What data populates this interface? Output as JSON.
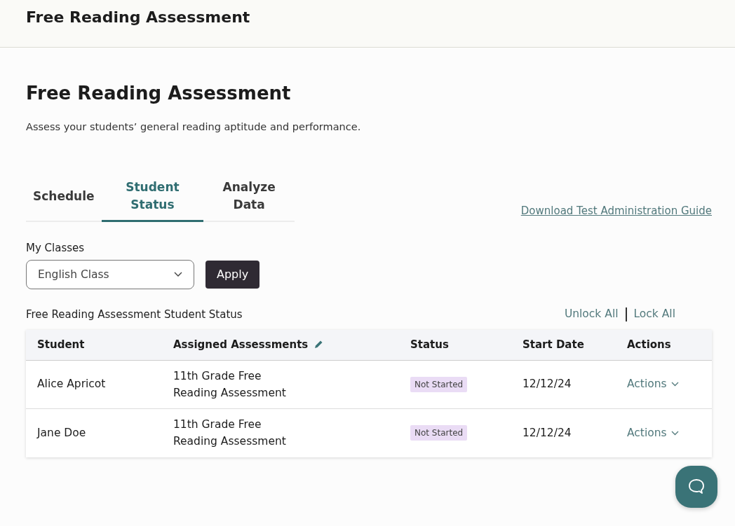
{
  "header": {
    "title": "Free Reading Assessment"
  },
  "page": {
    "title": "Free Reading Assessment",
    "subtitle": "Assess your students’ general reading aptitude and performance."
  },
  "tabs": [
    {
      "label": "Schedule",
      "selected": false
    },
    {
      "label": "Student Status",
      "selected": true
    },
    {
      "label": "Analyze Data",
      "selected": false
    }
  ],
  "guide_link": "Download Test Administration Guide",
  "class_filter": {
    "label": "My Classes",
    "value": "English Class",
    "button": "Apply"
  },
  "table": {
    "caption": "Free Reading Assessment Student Status",
    "bulk_actions": [
      "Unlock All",
      "Lock All"
    ],
    "columns": [
      "Student",
      "Assigned Assessments",
      "Status",
      "Start Date",
      "Actions"
    ],
    "rows": [
      {
        "student": "Alice Apricot",
        "assessment": "11th Grade Free Reading Assessment",
        "status": "Not Started",
        "start_date": "12/12/24",
        "actions": "Actions"
      },
      {
        "student": "Jane Doe",
        "assessment": "11th Grade Free Reading Assessment",
        "status": "Not Started",
        "start_date": "12/12/24",
        "actions": "Actions"
      }
    ]
  }
}
